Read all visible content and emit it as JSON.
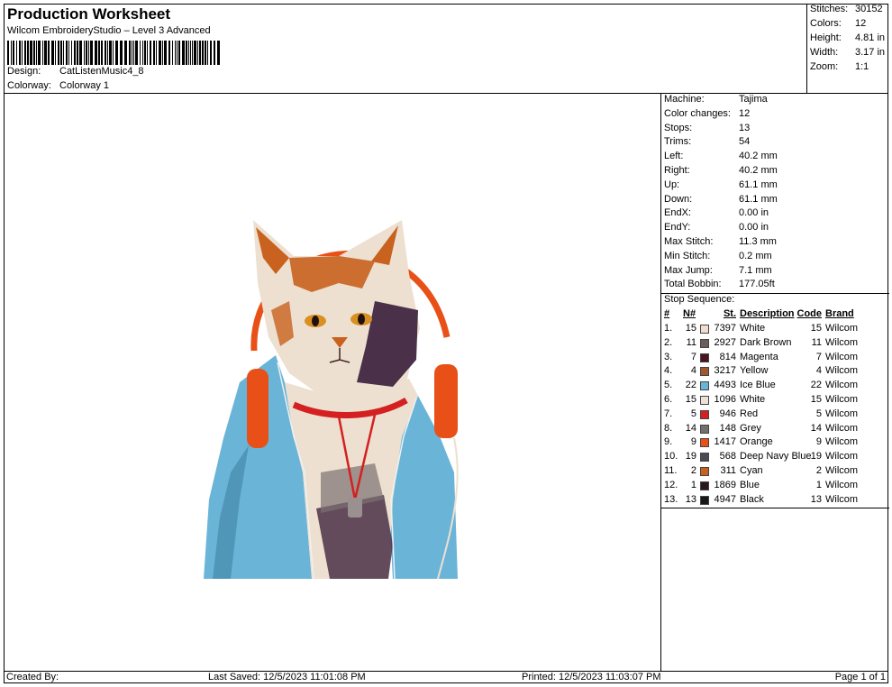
{
  "header": {
    "title": "Production Worksheet",
    "subtitle": "Wilcom EmbroideryStudio – Level 3 Advanced",
    "design_label": "Design:",
    "design_value": "CatListenMusic4_8",
    "colorway_label": "Colorway:",
    "colorway_value": "Colorway 1"
  },
  "stats": [
    {
      "label": "Stitches:",
      "value": "30152"
    },
    {
      "label": "Colors:",
      "value": "12"
    },
    {
      "label": "Height:",
      "value": "4.81 in"
    },
    {
      "label": "Width:",
      "value": "3.17 in"
    },
    {
      "label": "Zoom:",
      "value": "1:1"
    }
  ],
  "machine": [
    {
      "label": "Machine:",
      "value": "Tajima"
    },
    {
      "label": "Color changes:",
      "value": "12"
    },
    {
      "label": "Stops:",
      "value": "13"
    },
    {
      "label": "Trims:",
      "value": "54"
    },
    {
      "label": "Left:",
      "value": "40.2 mm"
    },
    {
      "label": "Right:",
      "value": "40.2 mm"
    },
    {
      "label": "Up:",
      "value": "61.1 mm"
    },
    {
      "label": "Down:",
      "value": "61.1 mm"
    },
    {
      "label": "EndX:",
      "value": "0.00 in"
    },
    {
      "label": "EndY:",
      "value": "0.00 in"
    },
    {
      "label": "Max Stitch:",
      "value": "11.3 mm"
    },
    {
      "label": "Min Stitch:",
      "value": "0.2 mm"
    },
    {
      "label": "Max Jump:",
      "value": "7.1 mm"
    },
    {
      "label": "Total Bobbin:",
      "value": "177.05ft"
    }
  ],
  "stop_sequence": {
    "title": "Stop Sequence:",
    "headers": {
      "num": "#",
      "n": "N#",
      "st": "St.",
      "desc": "Description",
      "code": "Code",
      "brand": "Brand"
    },
    "rows": [
      {
        "num": "1.",
        "n": "15",
        "color": "#f2dccd",
        "st": "7397",
        "desc": "White",
        "code": "15",
        "brand": "Wilcom"
      },
      {
        "num": "2.",
        "n": "11",
        "color": "#6b5e5a",
        "st": "2927",
        "desc": "Dark Brown",
        "code": "11",
        "brand": "Wilcom"
      },
      {
        "num": "3.",
        "n": "7",
        "color": "#4a1420",
        "st": "814",
        "desc": "Magenta",
        "code": "7",
        "brand": "Wilcom"
      },
      {
        "num": "4.",
        "n": "4",
        "color": "#a0582e",
        "st": "3217",
        "desc": "Yellow",
        "code": "4",
        "brand": "Wilcom"
      },
      {
        "num": "5.",
        "n": "22",
        "color": "#6ab4d8",
        "st": "4493",
        "desc": "Ice Blue",
        "code": "22",
        "brand": "Wilcom"
      },
      {
        "num": "6.",
        "n": "15",
        "color": "#ede0d8",
        "st": "1096",
        "desc": "White",
        "code": "15",
        "brand": "Wilcom"
      },
      {
        "num": "7.",
        "n": "5",
        "color": "#d42020",
        "st": "946",
        "desc": "Red",
        "code": "5",
        "brand": "Wilcom"
      },
      {
        "num": "8.",
        "n": "14",
        "color": "#707070",
        "st": "148",
        "desc": "Grey",
        "code": "14",
        "brand": "Wilcom"
      },
      {
        "num": "9.",
        "n": "9",
        "color": "#e85018",
        "st": "1417",
        "desc": "Orange",
        "code": "9",
        "brand": "Wilcom"
      },
      {
        "num": "10.",
        "n": "19",
        "color": "#4a4a55",
        "st": "568",
        "desc": "Deep Navy Blue",
        "code": "19",
        "brand": "Wilcom"
      },
      {
        "num": "11.",
        "n": "2",
        "color": "#c8621e",
        "st": "311",
        "desc": "Cyan",
        "code": "2",
        "brand": "Wilcom"
      },
      {
        "num": "12.",
        "n": "1",
        "color": "#2a1820",
        "st": "1869",
        "desc": "Blue",
        "code": "1",
        "brand": "Wilcom"
      },
      {
        "num": "13.",
        "n": "13",
        "color": "#181818",
        "st": "4947",
        "desc": "Black",
        "code": "13",
        "brand": "Wilcom"
      }
    ]
  },
  "footer": {
    "created_by": "Created By:",
    "last_saved": "Last Saved: 12/5/2023 11:01:08 PM",
    "printed": "Printed: 12/5/2023 11:03:07 PM",
    "page": "Page 1 of 1"
  },
  "design_colors": {
    "jacket": "#6ab4d8",
    "jacket_shadow": "#3a7ea0",
    "fur_white": "#ede0d0",
    "fur_orange": "#c8621e",
    "fur_dark": "#4a3048",
    "fur_grey": "#7a7070",
    "headphone": "#e85018",
    "collar": "#d42020",
    "eye": "#d89020"
  }
}
